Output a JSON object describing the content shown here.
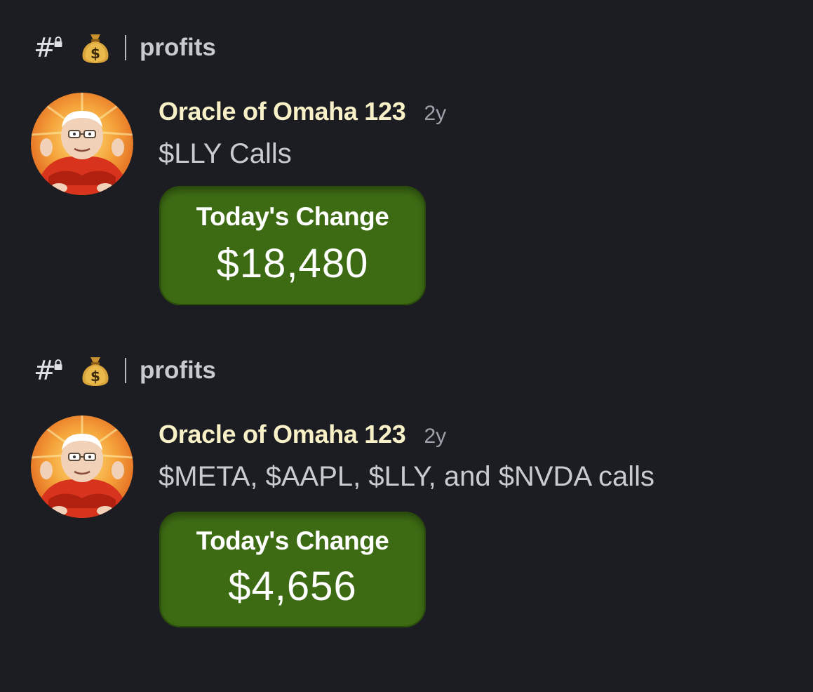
{
  "posts": [
    {
      "channel": {
        "hash_icon": "hashtag-lock-icon",
        "emoji_icon": "money-bag-icon",
        "name": "profits"
      },
      "message": {
        "avatar_icon": "avatar",
        "username": "Oracle of Omaha 123",
        "timestamp": "2y",
        "text": "$LLY Calls",
        "attachment": {
          "title": "Today's Change",
          "value": "$18,480"
        }
      }
    },
    {
      "channel": {
        "hash_icon": "hashtag-lock-icon",
        "emoji_icon": "money-bag-icon",
        "name": "profits"
      },
      "message": {
        "avatar_icon": "avatar",
        "username": "Oracle of Omaha 123",
        "timestamp": "2y",
        "text": "$META, $AAPL, $LLY, and $NVDA calls",
        "attachment": {
          "title": "Today's Change",
          "value": "$4,656"
        }
      }
    }
  ],
  "colors": {
    "background": "#1c1d22",
    "username": "#f8f0c6",
    "message_text": "#c9cbd1",
    "timestamp": "#9fa2aa",
    "attachment_bg": "#3d6b14"
  }
}
